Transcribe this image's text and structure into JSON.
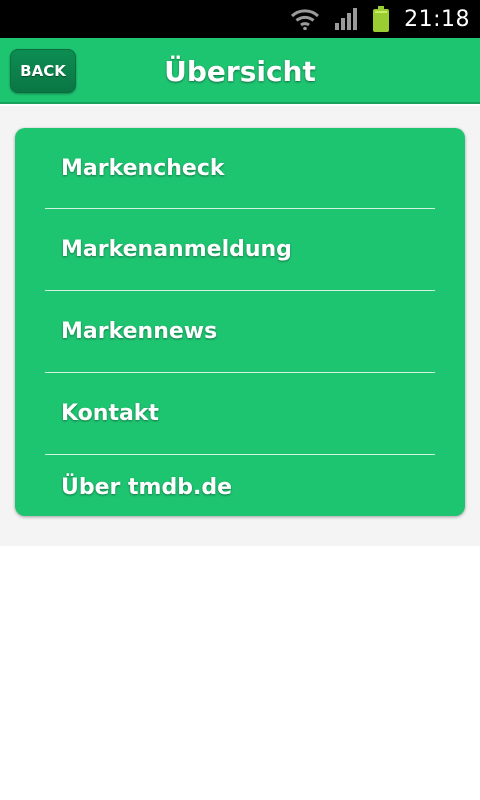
{
  "status_bar": {
    "time": "21:18",
    "icons": [
      "wifi-icon",
      "signal-icon",
      "battery-icon"
    ]
  },
  "title_bar": {
    "back_label": "BACK",
    "title": "Übersicht"
  },
  "menu": {
    "items": [
      {
        "label": "Markencheck"
      },
      {
        "label": "Markenanmeldung"
      },
      {
        "label": "Markennews"
      },
      {
        "label": "Kontakt"
      },
      {
        "label": "Über tmdb.de"
      }
    ]
  },
  "colors": {
    "accent": "#1ec571",
    "back_button": "#0a7644",
    "status_bar": "#000000"
  }
}
